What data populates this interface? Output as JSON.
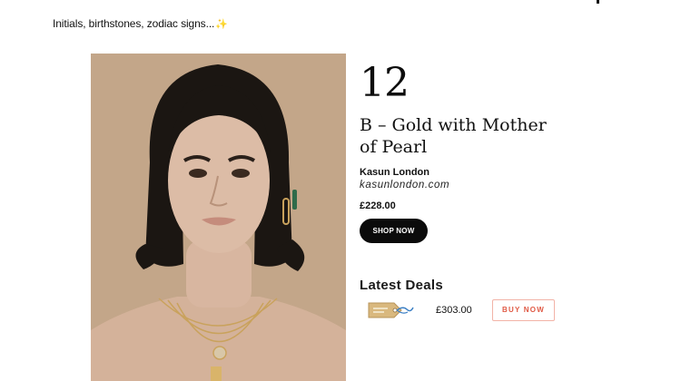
{
  "intro": {
    "text": "Initials, birthstones, zodiac signs...",
    "emoji": "✨"
  },
  "item": {
    "rank": "12",
    "title": "B – Gold with Mother of Pearl",
    "brand": "Kasun London",
    "site": "kasunlondon.com",
    "price": "£228.00",
    "shop_label": "SHOP NOW",
    "image": "photo-model-with-gold-initial-necklace"
  },
  "deals": {
    "title": "Latest Deals",
    "items": [
      {
        "icon": "price-tag-icon",
        "price": "£303.00",
        "button_label": "BUY NOW"
      }
    ]
  },
  "colors": {
    "button_dark": "#0b0b0b",
    "accent": "#e05a45",
    "accent_border": "#f2b3a7"
  }
}
